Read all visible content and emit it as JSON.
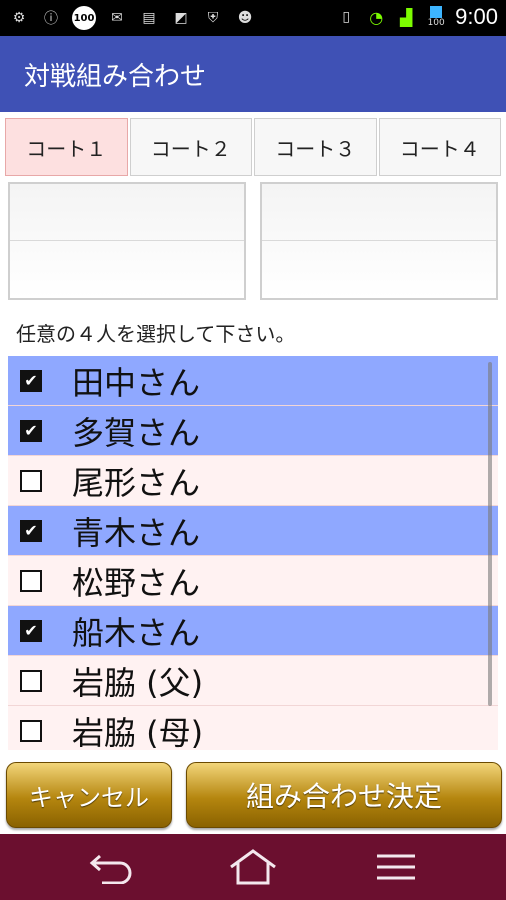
{
  "status_bar": {
    "time": "9:00",
    "notif_badge": "100",
    "battery_label": "100",
    "left_icons": [
      "android-settings-icon",
      "info-icon",
      "badge-100-icon",
      "mail-icon",
      "calendar-icon",
      "photo-icon",
      "shield-icon",
      "android-icon"
    ],
    "right_icons": [
      "vibrate-icon",
      "wifi-icon",
      "signal-icon",
      "battery-icon"
    ]
  },
  "app_bar": {
    "title": "対戦組み合わせ",
    "color": "#3f51b5"
  },
  "tabs": [
    {
      "label": "コート１",
      "active": true
    },
    {
      "label": "コート２",
      "active": false
    },
    {
      "label": "コート３",
      "active": false
    },
    {
      "label": "コート４",
      "active": false
    }
  ],
  "instruction": "任意の４人を選択して下さい。",
  "players": [
    {
      "name": "田中さん",
      "checked": true
    },
    {
      "name": "多賀さん",
      "checked": true
    },
    {
      "name": "尾形さん",
      "checked": false
    },
    {
      "name": "青木さん",
      "checked": true
    },
    {
      "name": "松野さん",
      "checked": false
    },
    {
      "name": "船木さん",
      "checked": true
    },
    {
      "name": "岩脇 (父)",
      "checked": false
    },
    {
      "name": "岩脇 (母)",
      "checked": false
    }
  ],
  "buttons": {
    "cancel": "キャンセル",
    "confirm": "組み合わせ決定"
  },
  "colors": {
    "selected_row": "#8fa8ff",
    "unselected_row": "#fff2f2",
    "nav_bar": "#6b0f2f",
    "button_gold": "#b5860f"
  },
  "nav_icons": [
    "back-icon",
    "home-icon",
    "menu-icon"
  ]
}
